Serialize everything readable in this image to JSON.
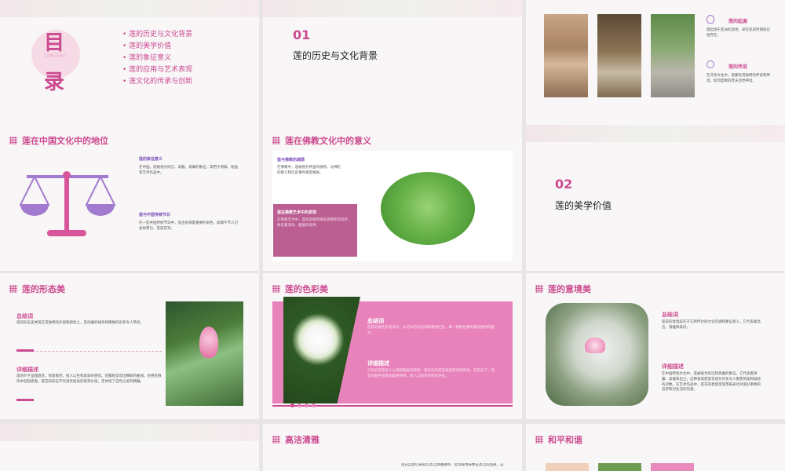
{
  "s1": {
    "title_a": "目",
    "title_b": "录",
    "watermark": "CONTENT",
    "items": [
      "• 莲的历史与文化背景",
      "• 莲的美学价值",
      "• 莲的象征意义",
      "• 莲的应用与艺术表现",
      "• 莲文化的传承与创新"
    ]
  },
  "s2": {
    "num": "01",
    "title": "莲的历史与文化背景"
  },
  "s3": {
    "h1": "莲的起源",
    "t1": "莲起源于亚洲的湿地，早在史前时期就已经存在。",
    "h2": "莲的传说",
    "t2": "在许多文化中，莲都有其独特的传说和神话，如印度教的梵天创世神话。"
  },
  "s4": {
    "title": "莲在中国文化中的地位",
    "h1": "莲的象征意义",
    "t1": "在中国，莲被视为纯洁、高雅、清廉的象征，常用于诗歌、绘画等艺术作品中。",
    "h2": "莲与中国传统节日",
    "t2": "在一些中国传统节日中，莲也扮演着重要的角色，如端午节人们会採荷包、赏莲花等。"
  },
  "s5": {
    "title": "莲在佛教文化中的意义",
    "h1": "莲与佛教的渊源",
    "t1": "在佛教中，莲被视为神圣的植物，与佛陀的教义和历史事件紧密相关。",
    "h2": "莲在佛教艺术中的表现",
    "t2": "在佛教艺术中，莲经常被用来表现佛陀和菩萨，象征着清净、超脱的境界。"
  },
  "s6": {
    "num": "02",
    "title": "莲的美学价值"
  },
  "s7": {
    "title": "莲的形态美",
    "h1": "总结词",
    "t1": "莲的形态美体现在其独特的外观和结构上，其优雅的线条和精致的形状令人赞叹。",
    "h2": "详细描述",
    "t2": "莲的叶子呈圆盘状，绿意盎然，给人以生机勃勃的感觉。花瓣则呈现出细腻的曲线，仿佛在微风中轻轻摇曳。莲花的形态不仅具有很高的观赏价值，还体现了自然之美的精髓。"
  },
  "s8": {
    "title": "莲的色彩美",
    "h1": "总结词",
    "t1": "莲花的颜色丰富多彩，从洁白的白色到鲜艳的红色，每一种颜色都有着其独特的魅力。",
    "h2": "详细描述",
    "t2": "白色的莲花给人以清新脱俗的感觉，而红色的莲花则显得热情奔放。在阳光下，莲花的颜色会更加鲜艳夺目，给人以强烈的视觉冲击。"
  },
  "s9": {
    "title": "莲的意境美",
    "h1": "总结词",
    "t1": "莲花的意境美在于它所传达的文化内涵和象征意义，它代表着高洁、清雅和美好。",
    "h2": "详细描述",
    "t2": "在中国传统文化中，莲被视为纯洁和高雅的象征。它代表着清廉、高雅和出尘，这种意境使莲花成为许多文人墨客赞美和描绘的对象。在艺术作品中，莲花的意境常常用来表达对美好事物的追求和对生活的热爱。"
  },
  "s11": {
    "title": "高洁清雅",
    "t1": "莲花自古以来就以高洁清雅著称，常常被用来象征高洁的品质。这"
  },
  "s12": {
    "title": "和平和谐"
  }
}
